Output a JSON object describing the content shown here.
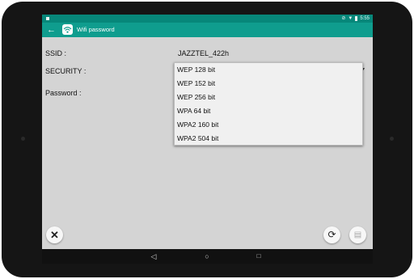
{
  "app": {
    "title": "Wifi password"
  },
  "status_bar": {
    "time": "5:55"
  },
  "form": {
    "ssid_label": "SSID :",
    "ssid_value": "JAZZTEL_422h",
    "security_label": "SECURITY :",
    "password_label": "Password :"
  },
  "dropdown": {
    "options": [
      "WEP 128 bit",
      "WEP 152 bit",
      "WEP 256 bit",
      "WPA 64 bit",
      "WPA2 160 bit",
      "WPA2 504 bit"
    ]
  },
  "icons": {
    "back": "arrow-left-icon",
    "app": "wifi-icon",
    "close": "close-icon",
    "refresh": "refresh-icon",
    "copy": "copy-icon"
  },
  "colors": {
    "accent": "#0f9d8e",
    "status_bar": "#07877a",
    "background": "#d4d4d4",
    "dropdown": "#f0f0f0"
  }
}
